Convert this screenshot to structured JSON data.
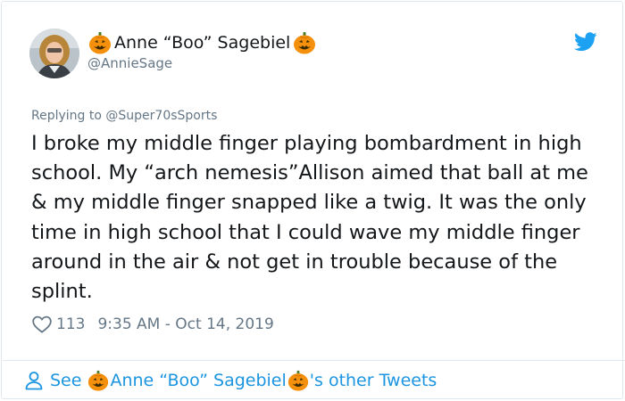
{
  "user": {
    "display_name": "Anne “Boo” Sagebiel",
    "handle": "@AnnieSage"
  },
  "reply": {
    "prefix": "Replying to",
    "handle": "@Super70sSports"
  },
  "tweet": {
    "text": "I broke my middle finger playing bombardment in high school. My “arch nemesis”Allison aimed that ball at me & my middle finger snapped like a twig. It was the only time in high school that I could wave my middle finger around in the air & not get in trouble because of the splint."
  },
  "meta": {
    "like_count": "113",
    "timestamp": "9:35 AM - Oct 14, 2019"
  },
  "footer": {
    "see_label": "See",
    "name": "Anne “Boo” Sagebiel",
    "suffix": "'s other Tweets"
  },
  "icons": {
    "bird": "twitter-bird-icon",
    "heart": "heart-icon",
    "person": "person-icon",
    "pumpkin": "jack-o-lantern-icon"
  },
  "colors": {
    "link_blue": "#1b95e0",
    "muted_gray": "#657786",
    "text_dark": "#14171a",
    "border": "#e1e8ed",
    "pumpkin_orange": "#f4900c"
  }
}
